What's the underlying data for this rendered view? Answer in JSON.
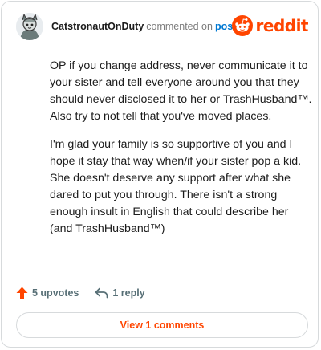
{
  "comment": {
    "username": "CatstronautOnDuty",
    "commented_on_text": "commented on",
    "post_link_text": "post",
    "paragraphs": [
      "OP if you change address, never communicate it to your sister and tell everyone around you that they should never disclosed it to her or TrashHusband™. Also try to not tell that you've moved places.",
      "I'm glad your family is so supportive of you and I hope it stay that way when/if your sister pop a kid. She doesn't deserve any support after what she dared to put you through. There isn't a strong enough insult in English that could describe her (and TrashHusband™)"
    ]
  },
  "brand": {
    "logo_text": "reddit",
    "logo_icon": "reddit-snoo-icon",
    "color": "#ff4500"
  },
  "actions": {
    "upvotes_label": "5 upvotes",
    "upvote_icon": "upvote-arrow-icon",
    "reply_label": "1 reply",
    "reply_icon": "reply-arrow-icon"
  },
  "view_comments": {
    "label": "View 1 comments"
  },
  "colors": {
    "accent": "#ff4500",
    "link": "#0079d3",
    "muted": "#576f76"
  }
}
